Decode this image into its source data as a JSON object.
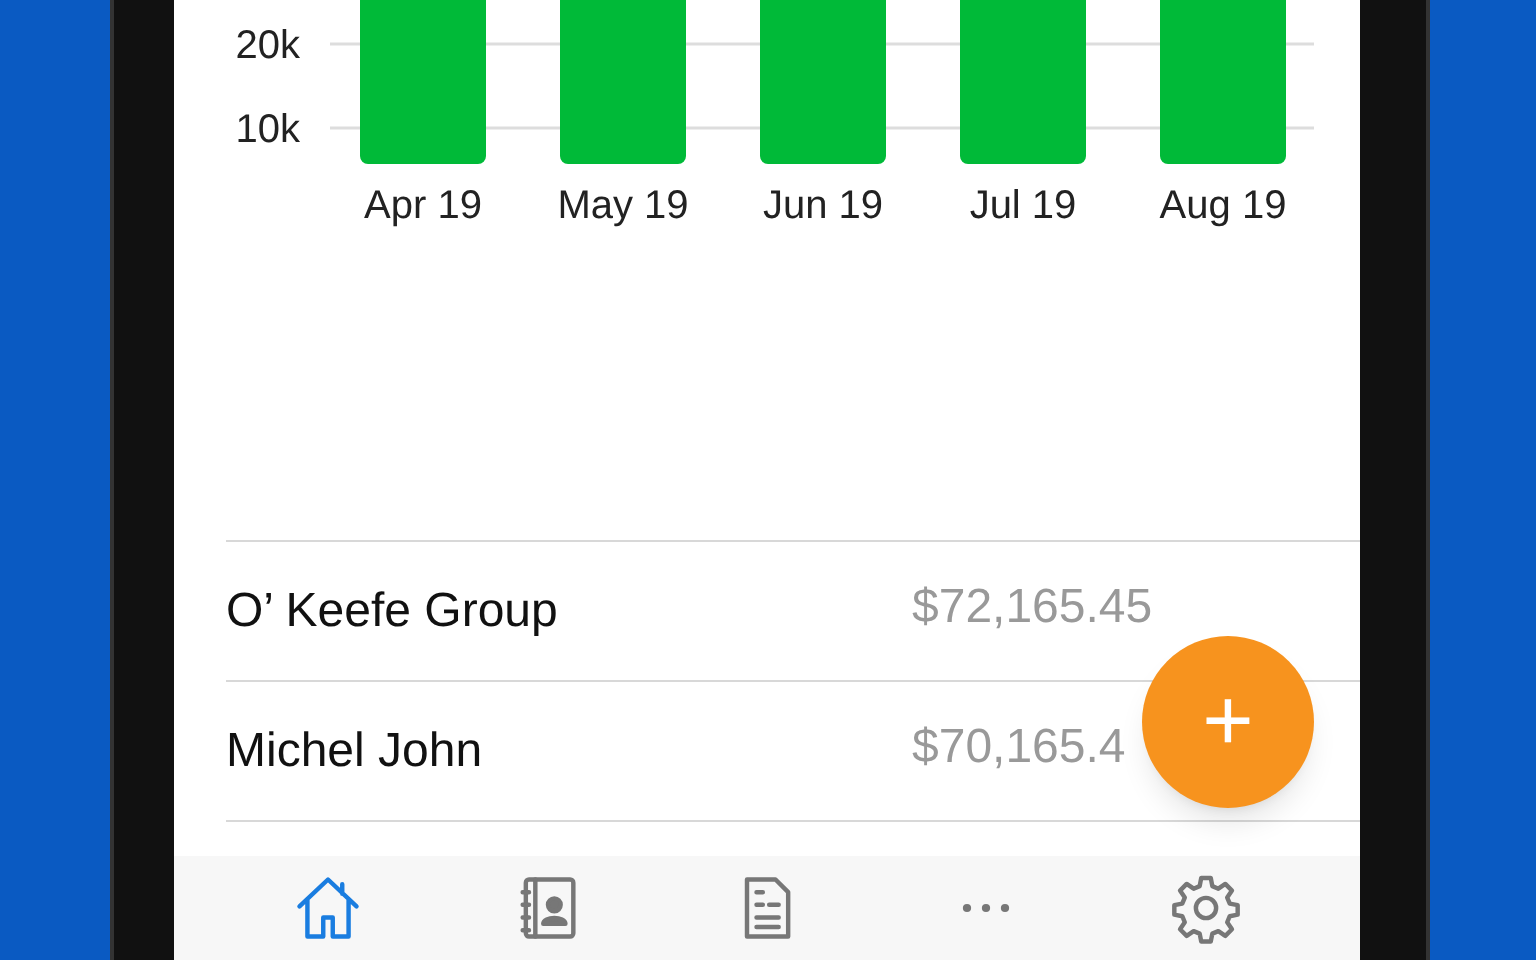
{
  "chart": {
    "y_tick_labels": [
      "20k",
      "10k"
    ],
    "months": [
      "Apr 19",
      "May 19",
      "Jun 19",
      "Jul 19",
      "Aug 19"
    ]
  },
  "customers": [
    {
      "name": "O’ Keefe Group",
      "amount": "$72,165.45"
    },
    {
      "name": "Michel John",
      "amount": "$70,165.4"
    }
  ],
  "fab": {
    "label": "+"
  },
  "tabs": [
    {
      "selected": true
    },
    {
      "selected": false
    },
    {
      "selected": false
    },
    {
      "selected": false
    },
    {
      "selected": false
    }
  ]
}
